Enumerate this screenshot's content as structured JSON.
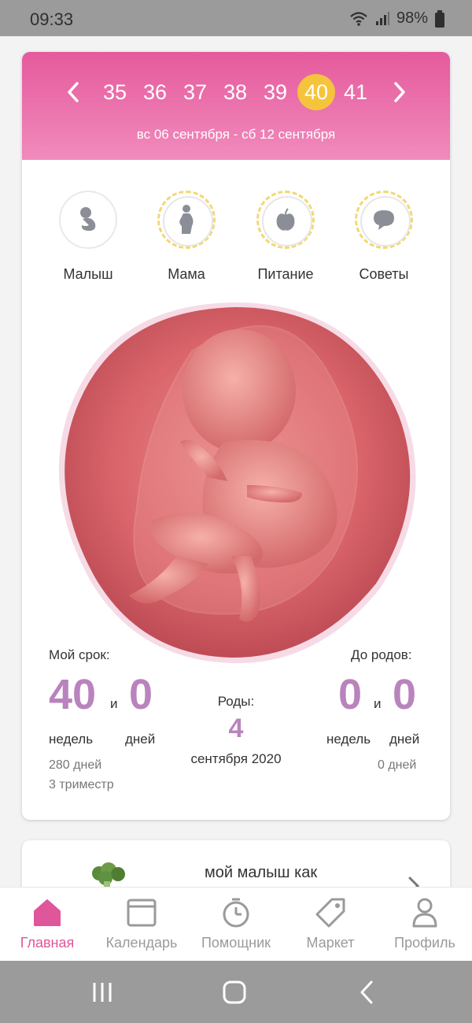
{
  "status": {
    "time": "09:33",
    "battery": "98%"
  },
  "week_selector": {
    "weeks": [
      "35",
      "36",
      "37",
      "38",
      "39",
      "40",
      "41"
    ],
    "selected": "40",
    "date_range": "вс 06 сентября - сб 12 сентября"
  },
  "categories": [
    {
      "label": "Малыш",
      "icon": "baby-icon"
    },
    {
      "label": "Мама",
      "icon": "pregnant-woman-icon"
    },
    {
      "label": "Питание",
      "icon": "apple-icon"
    },
    {
      "label": "Советы",
      "icon": "chat-bubble-icon"
    }
  ],
  "term": {
    "title": "Мой срок:",
    "weeks": "40",
    "conj": "и",
    "days": "0",
    "weeks_unit": "недель",
    "days_unit": "дней",
    "total_days": "280 дней",
    "trimester": "3 триместр"
  },
  "birth": {
    "title": "Роды:",
    "day": "4",
    "month_year": "сентября 2020"
  },
  "until_birth": {
    "title": "До родов:",
    "weeks": "0",
    "conj": "и",
    "days": "0",
    "weeks_unit": "недель",
    "days_unit": "дней",
    "total_days": "0 дней"
  },
  "preview_card": {
    "text": "мой малыш как"
  },
  "tabs": [
    {
      "label": "Главная",
      "icon": "home-icon",
      "active": true
    },
    {
      "label": "Календарь",
      "icon": "calendar-icon",
      "active": false
    },
    {
      "label": "Помощник",
      "icon": "stopwatch-icon",
      "active": false
    },
    {
      "label": "Маркет",
      "icon": "tag-icon",
      "active": false
    },
    {
      "label": "Профиль",
      "icon": "profile-icon",
      "active": false
    }
  ],
  "colors": {
    "accent_pink": "#e0569a",
    "highlight_yellow": "#f6c43c",
    "number_purple": "#b983bd"
  }
}
